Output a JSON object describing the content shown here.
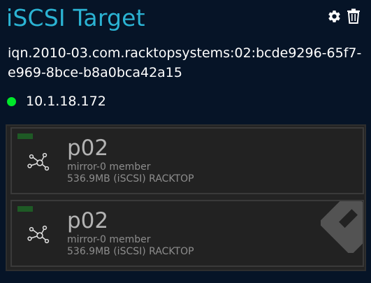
{
  "header": {
    "title": "iSCSI Target",
    "settings_icon": "gear-icon",
    "delete_icon": "trash-icon"
  },
  "target": {
    "iqn": "iqn.2010-03.com.racktopsystems:02:bcde9296-65f7-e969-8bce-b8a0bca42a15",
    "ip": "10.1.18.172",
    "status_color": "#00e82a"
  },
  "luns": [
    {
      "name": "p02",
      "role": "mirror-0 member",
      "details": "536.9MB (iSCSI) RACKTOP",
      "icon": "network-node-icon",
      "status_color": "#1e5a25"
    },
    {
      "name": "p02",
      "role": "mirror-0 member",
      "details": "536.9MB (iSCSI) RACKTOP",
      "icon": "network-node-icon",
      "status_color": "#1e5a25"
    }
  ],
  "colors": {
    "background": "#061427",
    "accent": "#2bb3d3",
    "card": "#222222"
  }
}
